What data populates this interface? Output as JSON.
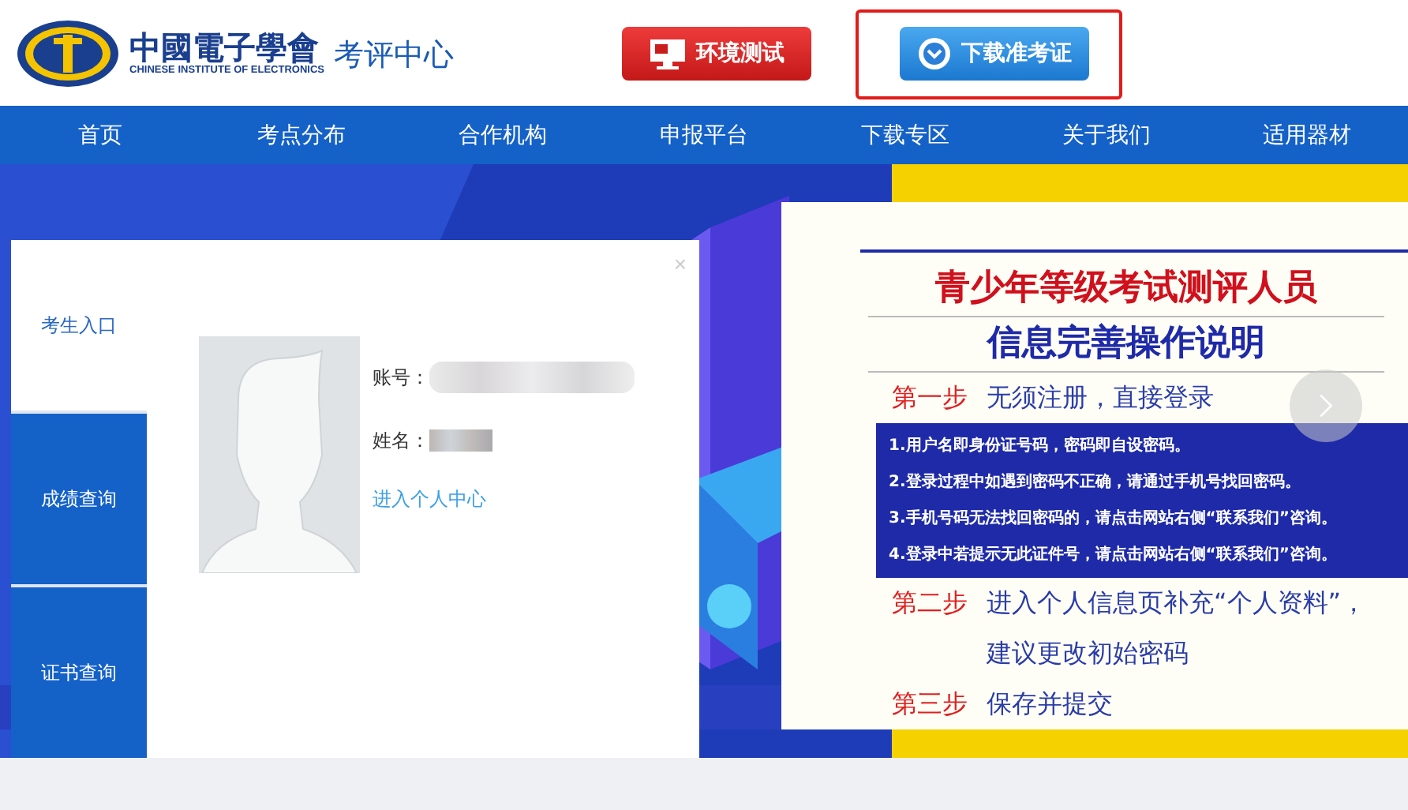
{
  "header": {
    "logo": {
      "name_cn": "中國電子學會",
      "name_en": "CHINESE INSTITUTE OF ELECTRONICS",
      "subtitle": "考评中心"
    },
    "buttons": [
      {
        "label": "环境测试",
        "kind": "test",
        "highlighted": false
      },
      {
        "label": "下载准考证",
        "kind": "download",
        "highlighted": true
      }
    ]
  },
  "nav": [
    {
      "label": "首页"
    },
    {
      "label": "考点分布"
    },
    {
      "label": "合作机构"
    },
    {
      "label": "申报平台"
    },
    {
      "label": "下载专区"
    },
    {
      "label": "关于我们"
    },
    {
      "label": "适用器材"
    }
  ],
  "login_panel": {
    "close": "×",
    "tabs": [
      {
        "label": "考生入口",
        "selected": true
      },
      {
        "label": "成绩查询",
        "selected": false
      },
      {
        "label": "证书查询",
        "selected": false
      }
    ],
    "fields": [
      {
        "label": "账号：",
        "kind": "account"
      },
      {
        "label": "姓名：",
        "kind": "name"
      }
    ],
    "link": "进入个人中心"
  },
  "banner": {
    "title_lines": [
      "青少年等级考试测评人员",
      "信息完善操作说明"
    ],
    "steps": [
      {
        "label": "第一步",
        "lines": [
          "无须注册，直接登录"
        ],
        "notes": [
          "1.用户名即身份证号码，密码即自设密码。",
          "2.登录过程中如遇到密码不正确，请通过手机号找回密码。",
          "3.手机号码无法找回密码的，请点击网站右侧“联系我们”咨询。",
          "4.登录中若提示无此证件号，请点击网站右侧“联系我们”咨询。"
        ]
      },
      {
        "label": "第二步",
        "lines": [
          "进入个人信息页补充“个人资料”，",
          "建议更改初始密码"
        ]
      },
      {
        "label": "第三步",
        "lines": [
          "保存并提交"
        ]
      }
    ]
  }
}
